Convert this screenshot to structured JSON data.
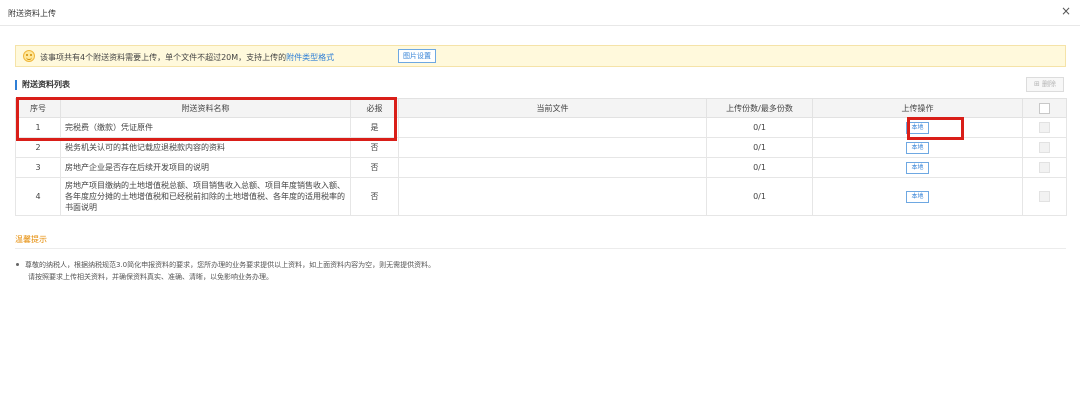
{
  "dialog": {
    "title": "附送资料上传",
    "close": "×"
  },
  "notice": {
    "text": "该事项共有4个附送资料需要上传，单个文件不超过20M，支持上传的",
    "link": "附件类型格式",
    "image_button": "图片设置"
  },
  "section": {
    "title": "附送资料列表",
    "delete_button": "⊞ 删除"
  },
  "table": {
    "headers": [
      "序号",
      "附送资料名称",
      "必报",
      "当前文件",
      "上传份数/最多份数",
      "上传操作"
    ],
    "rows": [
      {
        "no": "1",
        "name": "完税费（缴款）凭证原件",
        "required": "是",
        "current": "",
        "count": "0/1",
        "action": "本地"
      },
      {
        "no": "2",
        "name": "税务机关认可的其他记载应退税款内容的资料",
        "required": "否",
        "current": "",
        "count": "0/1",
        "action": "本地"
      },
      {
        "no": "3",
        "name": "房地产企业是否存在后续开发项目的说明",
        "required": "否",
        "current": "",
        "count": "0/1",
        "action": "本地"
      },
      {
        "no": "4",
        "name": "房地产项目缴纳的土地增值税总额、项目销售收入总额、项目年度销售收入额、各年度应分摊的土地增值税和已经税前扣除的土地增值税、各年度的适用税率的书面说明",
        "required": "否",
        "current": "",
        "count": "0/1",
        "action": "本地"
      }
    ]
  },
  "tips": {
    "title": "温馨提示",
    "line1": "尊敬的纳税人，根据纳税规范3.0简化申报资料的要求，您所办理的业务要求提供以上资料，如上面资料内容为空，则无需提供资料。",
    "line2": "请按照要求上传相关资料，并确保资料真实、准确、清晰，以免影响业务办理。"
  },
  "colors": {
    "accent": "#2f7fd6",
    "highlight": "#d91e18",
    "notice_bg": "#fff9dc",
    "tips_title": "#e58a00"
  }
}
